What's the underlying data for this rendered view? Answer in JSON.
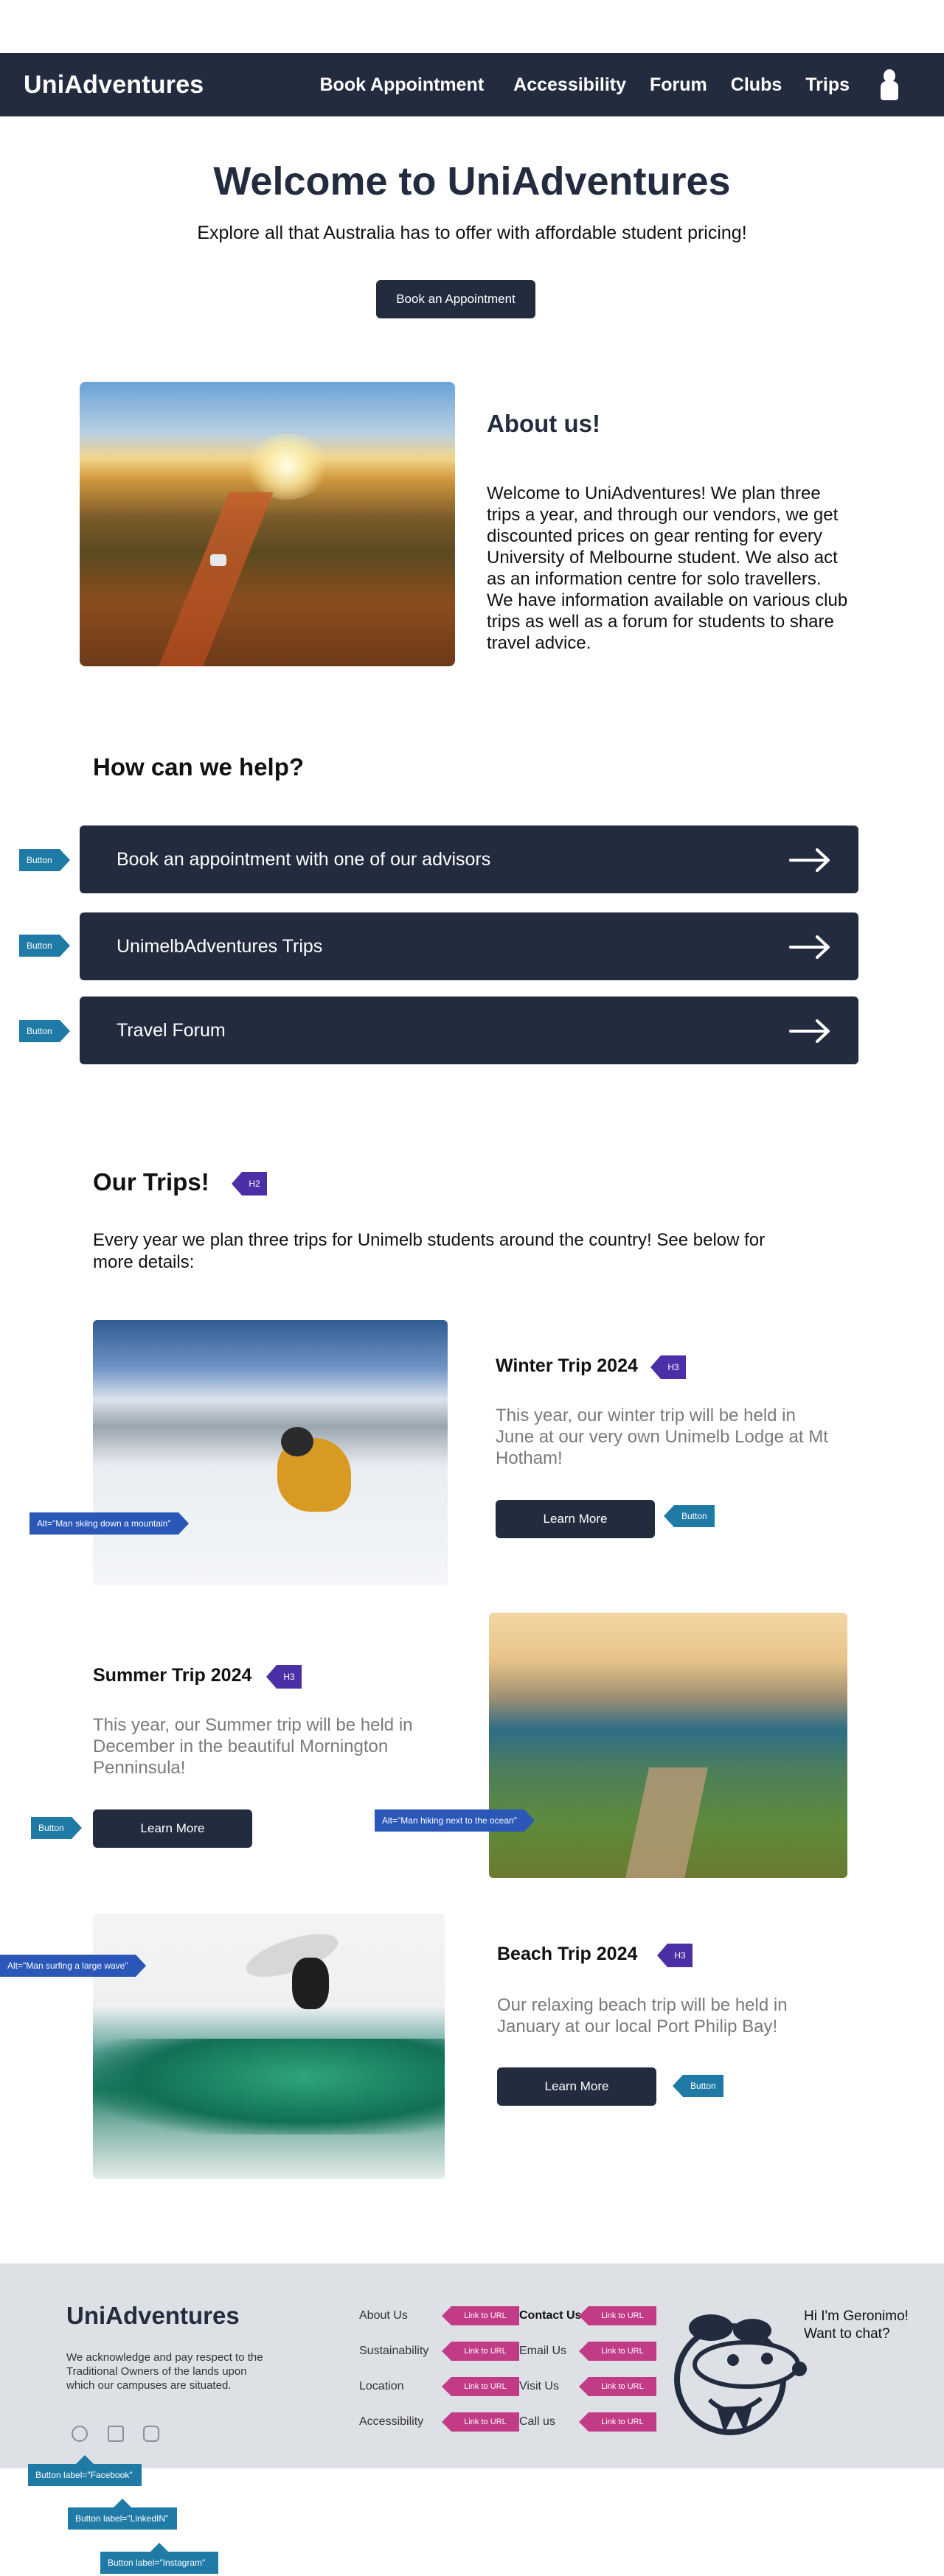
{
  "header": {
    "brand": "UniAdventures",
    "nav": [
      "Book Appointment",
      "Accessibility",
      "Forum",
      "Clubs",
      "Trips"
    ]
  },
  "hero": {
    "title": "Welcome to UniAdventures",
    "subtitle": "Explore all that Australia has to offer with affordable student pricing!",
    "button": "Book an Appointment"
  },
  "about": {
    "title": "About us!",
    "text": "Welcome to UniAdventures! We plan three trips a year, and through our vendors, we get discounted prices on gear renting for every University of Melbourne student. We also act as an information centre for solo travellers. We have information available on various club trips as well as a forum for students to share travel advice."
  },
  "help": {
    "title": "How can we help?",
    "buttons": [
      "Book an appointment with one of our advisors",
      "UnimelbAdventures Trips",
      "Travel Forum"
    ]
  },
  "trips": {
    "title": "Our Trips!",
    "intro": "Every year we plan three trips for Unimelb students around the country! See below for more details:",
    "items": [
      {
        "title": "Winter Trip 2024",
        "text": "This year, our winter trip will be held in June at our very own Unimelb Lodge at Mt Hotham!",
        "button": "Learn More",
        "alt_tag": "Alt=\"Man skiing down a mountain\""
      },
      {
        "title": "Summer Trip 2024",
        "text": "This year, our Summer trip will be held in December in the beautiful Mornington Penninsula!",
        "button": "Learn More",
        "alt_tag": "Alt=\"Man hiking next to the ocean\""
      },
      {
        "title": "Beach Trip 2024",
        "text": "Our relaxing beach trip will be held in January at our local Port Philip Bay!",
        "button": "Learn More",
        "alt_tag": "Alt=\"Man surfing a large wave\""
      }
    ]
  },
  "annotations": {
    "button": "Button",
    "h2": "H2",
    "h3": "H3",
    "link": "Link to URL",
    "facebook": "Button label=\"Facebook\"",
    "linkedin": "Button label=\"LinkedIN\"",
    "instagram": "Button label=\"Instagram\""
  },
  "footer": {
    "brand": "UniAdventures",
    "acknowledgement": "We acknowledge and pay respect to the Traditional Owners of the lands upon which our campuses are situated.",
    "col1": [
      "About Us",
      "Sustainability",
      "Location",
      "Accessibility"
    ],
    "col2": [
      "Contact Us",
      "Email Us",
      "Visit Us",
      "Call us"
    ],
    "chat": "Hi I'm Geronimo! Want to chat?",
    "social_icons": [
      "facebook-icon",
      "linkedin-icon",
      "instagram-icon"
    ]
  },
  "colors": {
    "primary": "#232c3f",
    "annotation_button": "#1f7aa5",
    "annotation_heading": "#4b2fa6",
    "annotation_link": "#c23b86",
    "footer_bg": "#dde0e5"
  }
}
